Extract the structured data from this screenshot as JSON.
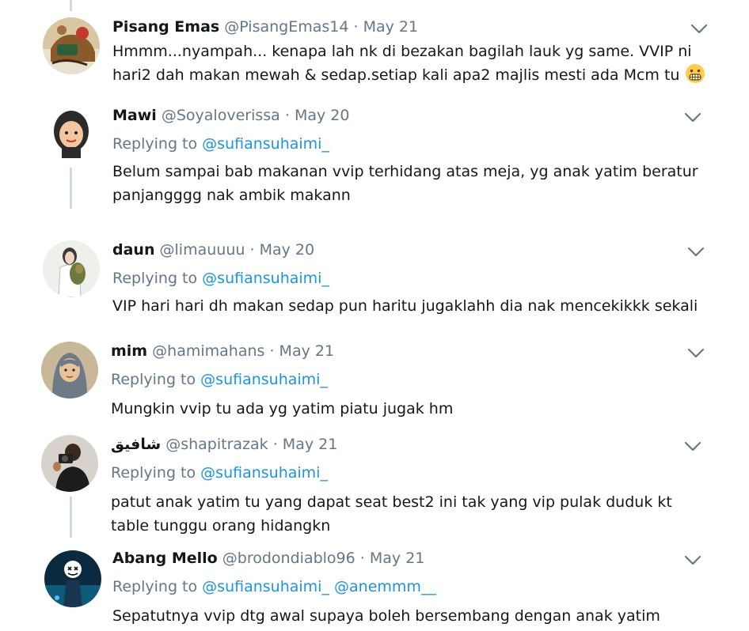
{
  "tweets": [
    {
      "name": "Pisang Emas",
      "handle": "@PisangEmas14",
      "dot": "·",
      "date": "May 21",
      "text": "Hmmm...nyampah... kenapa lah nk di bezakan bagilah lauk yg same. VVIP ni hari2 dah makan mewah & sedap.setiap kali apa2 majlis mesti ada Mcm tu",
      "emoji_icon": "grimacing-face-icon"
    },
    {
      "name": "Mawi",
      "handle": "@Soyaloverissa",
      "dot": "·",
      "date": "May 20",
      "replying_label": "Replying to",
      "replying_mention": "@sufiansuhaimi_",
      "text": "Belum sampai bab makanan vvip terhidang atas meja, yg anak yatim beratur panjangggg nak ambik makann"
    },
    {
      "name": "daun",
      "handle": "@limauuuu",
      "dot": "·",
      "date": "May 20",
      "replying_label": "Replying to",
      "replying_mention": "@sufiansuhaimi_",
      "text": "VIP hari hari dh makan sedap pun haritu jugaklahh dia nak mencekikkk sekali"
    },
    {
      "name": "mim",
      "handle": "@hamimahans",
      "dot": "·",
      "date": "May 21",
      "replying_label": "Replying to",
      "replying_mention": "@sufiansuhaimi_",
      "text": "Mungkin vvip tu ada yg yatim piatu jugak hm"
    },
    {
      "name": "شافيق",
      "handle": "@shapitrazak",
      "dot": "·",
      "date": "May 21",
      "replying_label": "Replying to",
      "replying_mention": "@sufiansuhaimi_",
      "text": "patut anak yatim tu yang dapat seat best2 ini tak yang vip pulak duduk kt table tunggu orang hidangkn"
    },
    {
      "name": "Abang Mello",
      "handle": "@brodondiablo96",
      "dot": "·",
      "date": "May 21",
      "replying_label": "Replying to",
      "replying_mention": "@sufiansuhaimi_",
      "replying_mention2": "@anemmm__",
      "text": "Sepatutnya vvip dtg awal supaya boleh bersembang dengan anak yatim"
    }
  ],
  "icons": {
    "more": "chevron-down-icon",
    "avatar": "avatar"
  },
  "colors": {
    "link": "#1b95e0",
    "muted": "#657786",
    "text": "#14171a",
    "thread": "#cfd9de"
  }
}
